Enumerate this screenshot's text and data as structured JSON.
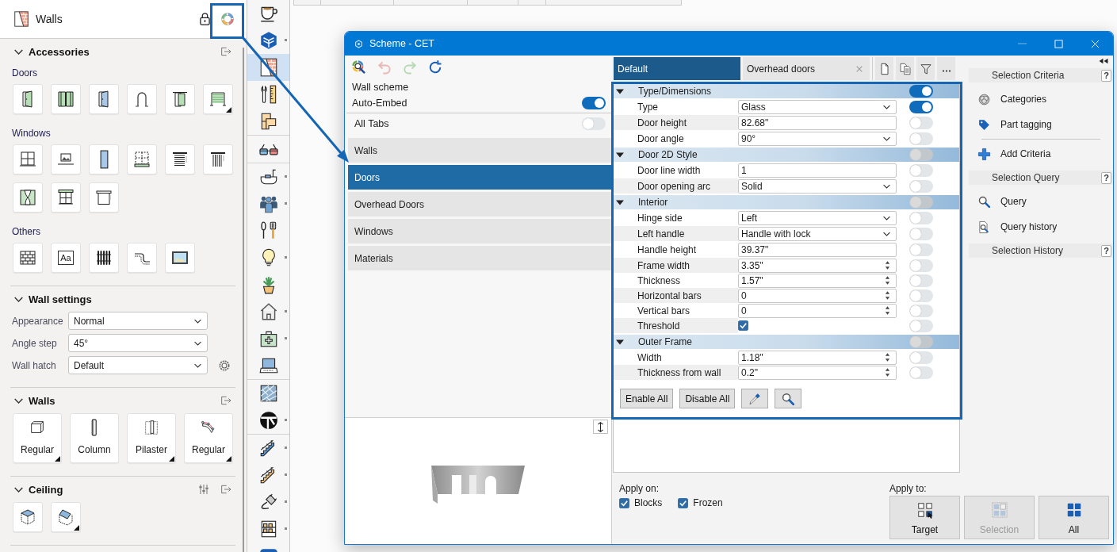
{
  "left_panel": {
    "title": "Walls",
    "sections": [
      {
        "kind": "groups",
        "title": "Accessories",
        "expanded": true,
        "groups": [
          {
            "label": "Doors",
            "tiles": [
              {
                "menu": false
              },
              {
                "menu": false
              },
              {
                "menu": false
              },
              {
                "menu": false
              },
              {
                "menu": false
              },
              {
                "menu": true
              }
            ]
          },
          {
            "label": "Windows",
            "tiles": [
              {
                "menu": false
              },
              {
                "menu": false
              },
              {
                "menu": false
              },
              {
                "menu": false
              },
              {
                "menu": false
              },
              {
                "menu": false
              },
              {
                "menu": false
              },
              {
                "menu": false
              },
              {
                "menu": false
              }
            ]
          },
          {
            "label": "Others",
            "tiles": [
              {
                "menu": false
              },
              {
                "menu": false,
                "text": "Aa"
              },
              {
                "menu": false
              },
              {
                "menu": false
              },
              {
                "menu": false
              }
            ]
          }
        ]
      },
      {
        "kind": "fields",
        "title": "Wall settings",
        "expanded": true,
        "fields": [
          {
            "label": "Appearance",
            "value": "Normal"
          },
          {
            "label": "Angle step",
            "value": "45°"
          },
          {
            "label": "Wall hatch",
            "value": "Default"
          }
        ]
      },
      {
        "kind": "labeled_tiles",
        "title": "Walls",
        "expanded": true,
        "tiles": [
          {
            "label": "Regular",
            "menu": true
          },
          {
            "label": "Column",
            "menu": false
          },
          {
            "label": "Pilaster",
            "menu": true
          },
          {
            "label": "Regular",
            "menu": true
          }
        ]
      },
      {
        "kind": "tiles",
        "title": "Ceiling",
        "expanded": true,
        "tiles": [
          {
            "menu": false
          },
          {
            "menu": true
          }
        ]
      }
    ]
  },
  "icon_bar": {
    "groups": [
      {
        "items": [
          {
            "selected": false,
            "menu": false
          },
          {
            "selected": false,
            "menu": true
          },
          {
            "selected": true,
            "menu": false
          },
          {
            "selected": false,
            "menu": false
          },
          {
            "selected": false,
            "menu": false
          }
        ]
      },
      {
        "items": [
          {
            "selected": false,
            "menu": false
          }
        ]
      },
      {
        "items": [
          {
            "selected": false,
            "menu": true
          },
          {
            "selected": false,
            "menu": true
          },
          {
            "selected": false,
            "menu": false
          },
          {
            "selected": false,
            "menu": true
          },
          {
            "selected": false,
            "menu": false
          },
          {
            "selected": false,
            "menu": true
          },
          {
            "selected": false,
            "menu": true
          },
          {
            "selected": false,
            "menu": false
          }
        ]
      },
      {
        "items": [
          {
            "selected": false,
            "menu": false
          },
          {
            "selected": false,
            "menu": true
          }
        ]
      },
      {
        "items": [
          {
            "selected": false,
            "menu": true
          },
          {
            "selected": false,
            "menu": true
          },
          {
            "selected": false,
            "menu": true
          },
          {
            "selected": false,
            "menu": true
          },
          {
            "selected": false,
            "menu": false
          }
        ]
      }
    ]
  },
  "dialog": {
    "title": "Scheme - CET",
    "toolbar": [
      {
        "disabled": false
      },
      {
        "disabled": true
      },
      {
        "disabled": true
      },
      {
        "disabled": false
      }
    ],
    "scheme_name": "Wall scheme",
    "switches": [
      {
        "label": "Auto-Embed",
        "on": true
      },
      {
        "label": "All Tabs",
        "on": false
      }
    ],
    "categories": [
      {
        "label": "Walls",
        "selected": false
      },
      {
        "label": "Doors",
        "selected": true
      },
      {
        "label": "Overhead Doors",
        "selected": false
      },
      {
        "label": "Windows",
        "selected": false
      },
      {
        "label": "Materials",
        "selected": false
      }
    ],
    "tabs": [
      {
        "label": "Default",
        "selected": true,
        "closable": false
      },
      {
        "label": "Overhead doors",
        "selected": false,
        "closable": true
      }
    ],
    "property_groups": [
      {
        "title": "Type/Dimensions",
        "expanded": true,
        "on": true,
        "rows": [
          {
            "label": "Type",
            "kind": "select",
            "value": "Glass",
            "on": true
          },
          {
            "label": "Door height",
            "kind": "text",
            "value": "82.68\"",
            "on": false
          },
          {
            "label": "Door angle",
            "kind": "select",
            "value": "90°",
            "on": false
          }
        ]
      },
      {
        "title": "Door 2D Style",
        "expanded": true,
        "on": false,
        "rows": [
          {
            "label": "Door line width",
            "kind": "text",
            "value": "1",
            "on": false
          },
          {
            "label": "Door opening arc",
            "kind": "select",
            "value": "Solid",
            "on": false
          }
        ]
      },
      {
        "title": "Interior",
        "expanded": true,
        "on": false,
        "rows": [
          {
            "label": "Hinge side",
            "kind": "select",
            "value": "Left",
            "on": false
          },
          {
            "label": "Left handle",
            "kind": "select",
            "value": "Handle with lock",
            "on": false
          },
          {
            "label": "Handle height",
            "kind": "text",
            "value": "39.37\"",
            "on": false
          },
          {
            "label": "Frame width",
            "kind": "number",
            "value": "3.35\"",
            "on": false
          },
          {
            "label": "Thickness",
            "kind": "number",
            "value": "1.57\"",
            "on": false
          },
          {
            "label": "Horizontal bars",
            "kind": "number",
            "value": "0",
            "on": false
          },
          {
            "label": "Vertical bars",
            "kind": "number",
            "value": "0",
            "on": false
          },
          {
            "label": "Threshold",
            "kind": "checkbox",
            "checked": true,
            "on": false
          }
        ]
      },
      {
        "title": "Outer Frame",
        "expanded": true,
        "on": false,
        "rows": [
          {
            "label": "Width",
            "kind": "number",
            "value": "1.18\"",
            "on": false
          },
          {
            "label": "Thickness from wall",
            "kind": "number",
            "value": "0.2\"",
            "on": false
          }
        ]
      }
    ],
    "grid_buttons": [
      {
        "kind": "text",
        "label": "Enable All"
      },
      {
        "kind": "text",
        "label": "Disable All"
      },
      {
        "kind": "eyedropper"
      },
      {
        "kind": "search"
      }
    ],
    "apply_on": {
      "label": "Apply on:",
      "options": [
        {
          "label": "Blocks",
          "checked": true
        },
        {
          "label": "Frozen",
          "checked": true
        }
      ]
    },
    "apply_to": {
      "label": "Apply to:",
      "buttons": [
        {
          "label": "Target",
          "disabled": false
        },
        {
          "label": "Selection",
          "disabled": true
        },
        {
          "label": "All",
          "disabled": false
        }
      ]
    },
    "side": {
      "sections": [
        {
          "title": "Selection Criteria",
          "help": "?",
          "items": [
            {
              "label": "Categories",
              "kind": "categories"
            },
            {
              "label": "Part tagging",
              "kind": "tag"
            },
            {
              "label": "Add Criteria",
              "kind": "add"
            }
          ]
        },
        {
          "title": "Selection Query",
          "help": "?",
          "items": [
            {
              "label": "Query",
              "kind": "query"
            },
            {
              "label": "Query history",
              "kind": "history"
            }
          ]
        },
        {
          "title": "Selection History",
          "help": "?"
        }
      ]
    }
  }
}
